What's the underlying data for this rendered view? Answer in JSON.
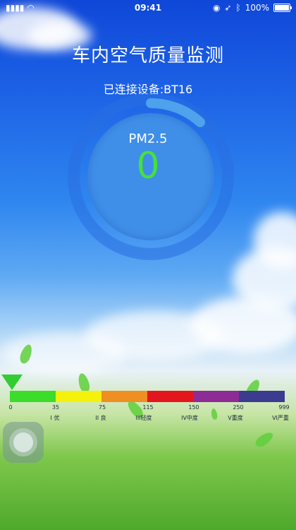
{
  "status_bar": {
    "time": "09:41",
    "battery": "100%"
  },
  "header": {
    "title": "车内空气质量监测",
    "device": "已连接设备:BT16"
  },
  "gauge": {
    "label": "PM2.5",
    "value": "0"
  },
  "scale": {
    "colors": [
      "#3bdc2a",
      "#f4f20a",
      "#ef8f22",
      "#e4161d",
      "#8d2c95",
      "#3b3b8f"
    ],
    "ticks": [
      "0",
      "35",
      "75",
      "115",
      "150",
      "250",
      "999"
    ],
    "grades": [
      "I 优",
      "II 良",
      "III轻度",
      "IV中度",
      "V重度",
      "VI严重"
    ]
  }
}
